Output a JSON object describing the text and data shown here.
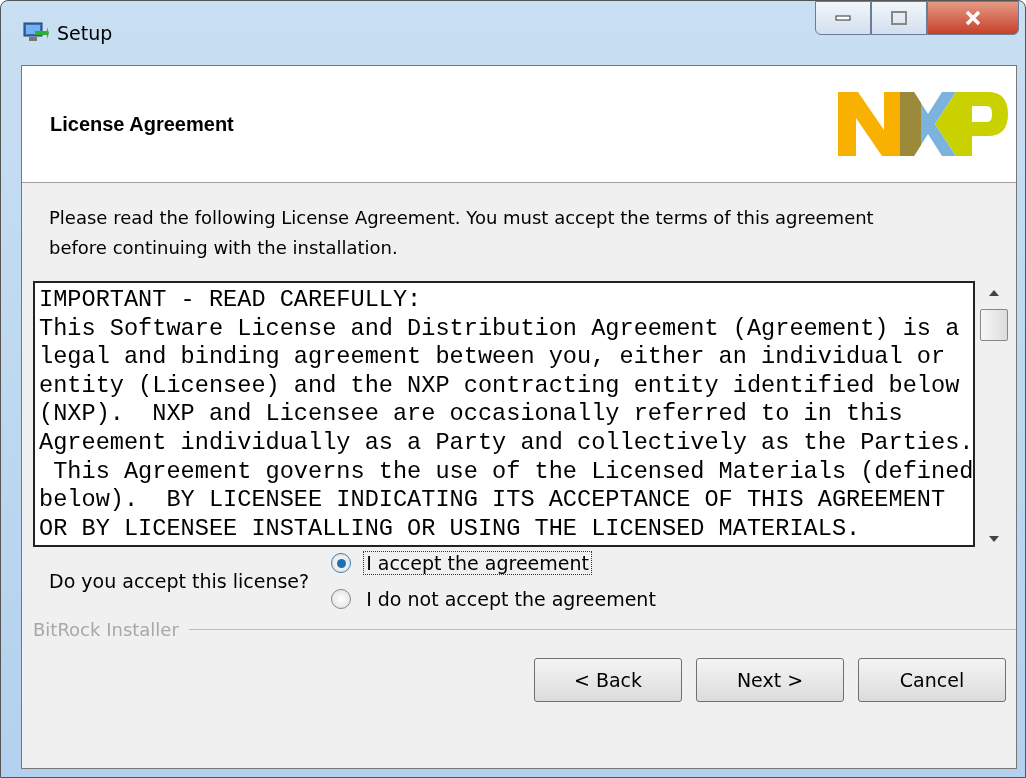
{
  "window": {
    "title": "Setup"
  },
  "header": {
    "title": "License Agreement"
  },
  "intro": "Please read the following License Agreement. You must accept the terms of this agreement before continuing with the installation.",
  "license_lines": [
    "IMPORTANT - READ CAREFULLY:",
    "This Software License and Distribution Agreement (Agreement) is a",
    "legal and binding agreement between you, either an individual or",
    "entity (Licensee) and the NXP contracting entity identified below",
    "(NXP).  NXP and Licensee are occasionally referred to in this",
    "Agreement individually as a Party and collectively as the Parties.",
    " This Agreement governs the use of the Licensed Materials (defined",
    "below).  BY LICENSEE INDICATING ITS ACCEPTANCE OF THIS AGREEMENT",
    "OR BY LICENSEE INSTALLING OR USING THE LICENSED MATERIALS."
  ],
  "question": "Do you accept this license?",
  "options": [
    {
      "label": "I accept the agreement",
      "selected": true
    },
    {
      "label": "I do not accept the agreement",
      "selected": false
    }
  ],
  "frame_label": "BitRock Installer",
  "buttons": [
    "< Back",
    "Next >",
    "Cancel"
  ]
}
